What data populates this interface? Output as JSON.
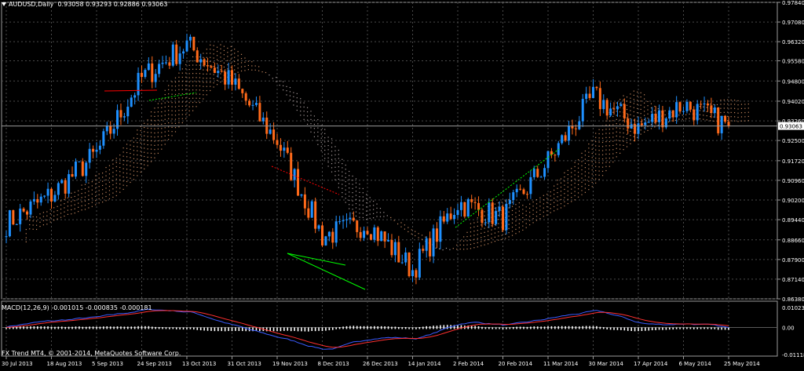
{
  "header": {
    "symbol": "AUDUSD,Daily",
    "ohlc": "0.93058 0.93293 0.92886 0.93063"
  },
  "macd_header": "MACD(12,26,9) -0.001015 -0.000835 -0.000181",
  "copyright": "FX Trend MT4, © 2001-2014, MetaQuotes Software Corp.",
  "price_axis": {
    "ticks": [
      "0.97840",
      "0.97080",
      "0.96320",
      "0.95580",
      "0.94800",
      "0.94020",
      "0.93260",
      "0.92500",
      "0.91720",
      "0.90960",
      "0.90200",
      "0.89440",
      "0.88660",
      "0.87900",
      "0.87140",
      "0.86380"
    ],
    "current_price": "0.93063"
  },
  "macd_axis": {
    "ticks": [
      "0.01023",
      "0.00",
      "-0.01118"
    ]
  },
  "date_axis": {
    "labels": [
      "30 Jul 2013",
      "18 Aug 2013",
      "5 Sep 2013",
      "24 Sep 2013",
      "13 Oct 2013",
      "31 Oct 2013",
      "19 Nov 2013",
      "8 Dec 2013",
      "26 Dec 2013",
      "14 Jan 2014",
      "2 Feb 2014",
      "20 Feb 2014",
      "11 Mar 2014",
      "30 Mar 2014",
      "17 Apr 2014",
      "6 May 2014",
      "25 May 2014"
    ]
  },
  "colors": {
    "background": "#000000",
    "grid": "#4a4a4a",
    "bull_candle": "#1e90ff",
    "bear_candle": "#ff6a1a",
    "cloud_bull": "#e8a070",
    "cloud_bear": "#c8b8b8",
    "macd_line": "#3a5cff",
    "signal_line": "#ff3030",
    "divergence_green": "#00ff00",
    "divergence_red": "#ff0000"
  },
  "chart_data": {
    "type": "candlestick",
    "x": [
      "30 Jul 2013",
      "18 Aug 2013",
      "5 Sep 2013",
      "24 Sep 2013",
      "13 Oct 2013",
      "31 Oct 2013",
      "19 Nov 2013",
      "8 Dec 2013",
      "26 Dec 2013",
      "14 Jan 2014",
      "2 Feb 2014",
      "20 Feb 2014",
      "11 Mar 2014",
      "30 Mar 2014",
      "17 Apr 2014",
      "6 May 2014",
      "25 May 2014"
    ],
    "series": [
      {
        "values": [
          0.893,
          0.904,
          0.92,
          0.949,
          0.962,
          0.947,
          0.925,
          0.888,
          0.893,
          0.875,
          0.901,
          0.895,
          0.917,
          0.942,
          0.93,
          0.939,
          0.9306
        ]
      }
    ],
    "ylim": [
      0.8638,
      0.9784
    ],
    "macd": {
      "ylim": [
        -0.01118,
        0.01023
      ],
      "last": [
        -0.001015,
        -0.000835,
        -0.000181
      ]
    }
  }
}
